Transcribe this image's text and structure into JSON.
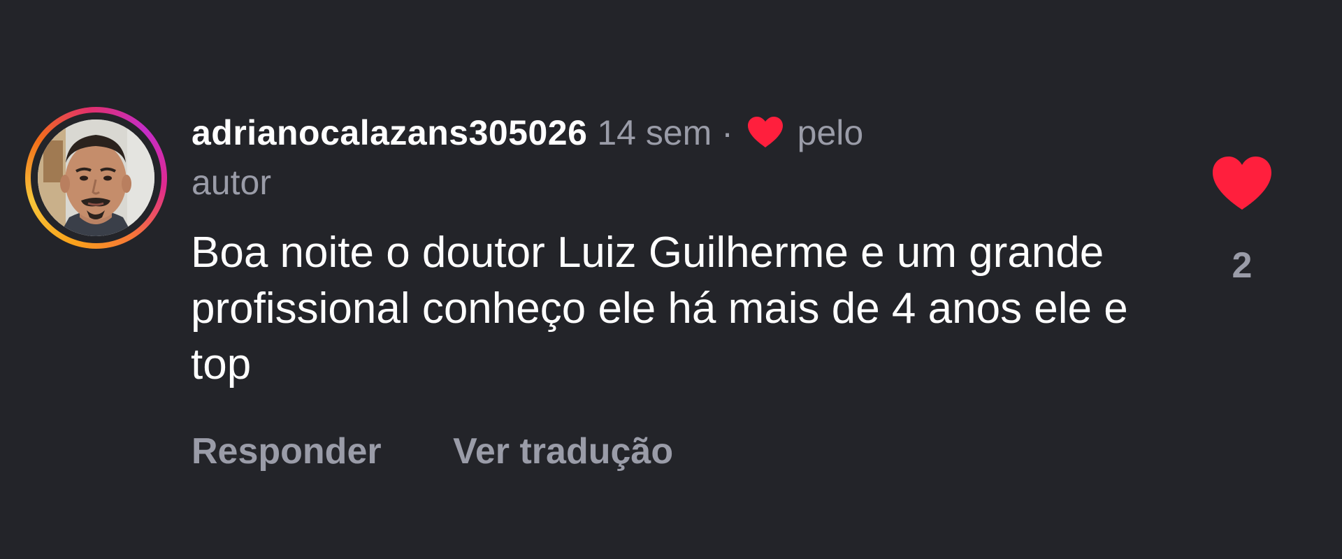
{
  "comment": {
    "username": "adrianocalazans305026",
    "time_ago": "14 sem",
    "separator": "·",
    "liked_by_label_part1": "pelo",
    "liked_by_label_part2": "autor",
    "text": "Boa noite o doutor Luiz Guilherme e um grande profissional conheço ele há mais de 4 anos ele e top",
    "author_heart_icon": "heart-icon",
    "author_heart_color": "#ff1f3d"
  },
  "actions": {
    "reply_label": "Responder",
    "translate_label": "Ver tradução"
  },
  "likes": {
    "icon": "heart-icon",
    "color": "#ff1f3d",
    "count": "2"
  },
  "colors": {
    "background": "#232429",
    "muted_text": "#9a9ca8",
    "primary_text": "#ffffff"
  }
}
